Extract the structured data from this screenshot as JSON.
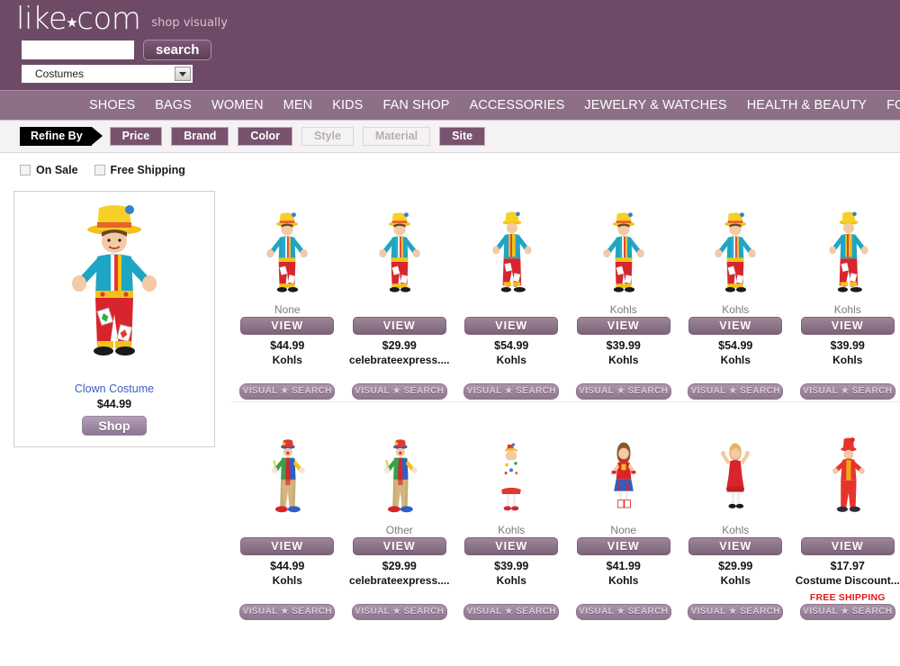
{
  "header": {
    "logo_text": "like.com",
    "logo_star": "★",
    "tagline": "shop visually",
    "search_value": "",
    "search_placeholder": "",
    "search_button_label": "search",
    "category_selected": "Costumes"
  },
  "nav": {
    "items": [
      {
        "label": "SHOES"
      },
      {
        "label": "BAGS"
      },
      {
        "label": "WOMEN"
      },
      {
        "label": "MEN"
      },
      {
        "label": "KIDS"
      },
      {
        "label": "FAN SHOP"
      },
      {
        "label": "ACCESSORIES"
      },
      {
        "label": "JEWELRY & WATCHES"
      },
      {
        "label": "HEALTH & BEAUTY"
      },
      {
        "label": "FOR"
      }
    ]
  },
  "refine": {
    "tag_label": "Refine By",
    "chips": [
      {
        "label": "Price",
        "enabled": true
      },
      {
        "label": "Brand",
        "enabled": true
      },
      {
        "label": "Color",
        "enabled": true
      },
      {
        "label": "Style",
        "enabled": false
      },
      {
        "label": "Material",
        "enabled": false
      },
      {
        "label": "Site",
        "enabled": true
      }
    ]
  },
  "filters": {
    "on_sale_label": "On Sale",
    "on_sale_checked": false,
    "free_shipping_label": "Free Shipping",
    "free_shipping_checked": false
  },
  "hero": {
    "title": "Clown Costume",
    "price": "$44.99",
    "shop_label": "Shop",
    "image_name": "boy-clown-costume-yellow-hat"
  },
  "labels": {
    "view_button": "VIEW",
    "visual_search_button": "VISUAL ★ SEARCH",
    "free_shipping_badge": "FREE SHIPPING"
  },
  "colors": {
    "header_purple": "#6d4b66",
    "nav_purple": "#8d6f88",
    "chip_purple": "#79526f",
    "link_blue": "#3b5fc0",
    "free_shipping_red": "#e01b1b"
  },
  "results": {
    "rows": [
      {
        "items": [
          {
            "brand_top": "None",
            "price": "$44.99",
            "merchant": "Kohls",
            "free_shipping": false,
            "image_name": "boy-clown-arms-up"
          },
          {
            "brand_top": "",
            "price": "$29.99",
            "merchant": "celebrateexpress....",
            "free_shipping": false,
            "image_name": "boy-clown-arms-up"
          },
          {
            "brand_top": "",
            "price": "$54.99",
            "merchant": "Kohls",
            "free_shipping": false,
            "image_name": "boy-clown-walking"
          },
          {
            "brand_top": "Kohls",
            "price": "$39.99",
            "merchant": "Kohls",
            "free_shipping": false,
            "image_name": "boy-clown-arms-up"
          },
          {
            "brand_top": "Kohls",
            "price": "$54.99",
            "merchant": "Kohls",
            "free_shipping": false,
            "image_name": "boy-clown-arms-up"
          },
          {
            "brand_top": "Kohls",
            "price": "$39.99",
            "merchant": "Kohls",
            "free_shipping": false,
            "image_name": "boy-clown-walking"
          }
        ]
      },
      {
        "items": [
          {
            "brand_top": "",
            "price": "$44.99",
            "merchant": "Kohls",
            "free_shipping": false,
            "image_name": "adult-clown-patchwork"
          },
          {
            "brand_top": "Other",
            "price": "$29.99",
            "merchant": "celebrateexpress....",
            "free_shipping": false,
            "image_name": "adult-clown-patchwork"
          },
          {
            "brand_top": "Kohls",
            "price": "$39.99",
            "merchant": "Kohls",
            "free_shipping": false,
            "image_name": "toddler-girl-clown-dress"
          },
          {
            "brand_top": "None",
            "price": "$41.99",
            "merchant": "Kohls",
            "free_shipping": false,
            "image_name": "girl-superhero-costume"
          },
          {
            "brand_top": "Kohls",
            "price": "$29.99",
            "merchant": "Kohls",
            "free_shipping": false,
            "image_name": "toddler-girl-red-dress"
          },
          {
            "brand_top": "",
            "price": "$17.97",
            "merchant": "Costume Discount...",
            "free_shipping": true,
            "image_name": "red-ringmaster-costume"
          }
        ]
      }
    ]
  }
}
